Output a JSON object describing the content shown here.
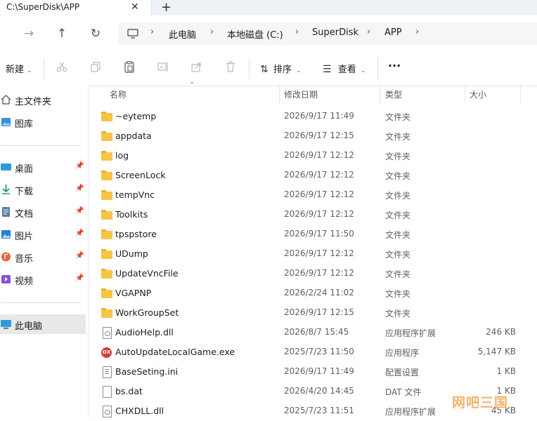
{
  "window": {
    "tab_title": "C:\\SuperDisk\\APP",
    "close_glyph": "✕",
    "add_glyph": "+"
  },
  "breadcrumb": [
    "此电脑",
    "本地磁盘 (C:)",
    "SuperDisk",
    "APP"
  ],
  "toolbar": {
    "new_label": "新建",
    "sort_label": "排序",
    "view_label": "查看",
    "more_label": "···"
  },
  "sidebar": {
    "items": [
      {
        "label": "主文件夹",
        "icon": "home-icon"
      },
      {
        "label": "图库",
        "icon": "gallery-icon"
      },
      {
        "label": "桌面",
        "icon": "desktop-icon",
        "pinned": true
      },
      {
        "label": "下载",
        "icon": "download-icon",
        "pinned": true
      },
      {
        "label": "文档",
        "icon": "documents-icon",
        "pinned": true
      },
      {
        "label": "图片",
        "icon": "pictures-icon",
        "pinned": true
      },
      {
        "label": "音乐",
        "icon": "music-icon",
        "pinned": true
      },
      {
        "label": "视频",
        "icon": "videos-icon",
        "pinned": true
      },
      {
        "label": "此电脑",
        "icon": "this-pc-icon",
        "selected": true
      }
    ]
  },
  "columns": {
    "name": "名称",
    "date": "修改日期",
    "type": "类型",
    "size": "大小"
  },
  "files": [
    {
      "name": "~eytemp",
      "date": "2026/9/17 11:49",
      "type": "文件夹",
      "size": "",
      "icon": "folder-icon"
    },
    {
      "name": "appdata",
      "date": "2026/9/17 12:15",
      "type": "文件夹",
      "size": "",
      "icon": "folder-icon"
    },
    {
      "name": "log",
      "date": "2026/9/17 12:12",
      "type": "文件夹",
      "size": "",
      "icon": "folder-icon"
    },
    {
      "name": "ScreenLock",
      "date": "2026/9/17 12:12",
      "type": "文件夹",
      "size": "",
      "icon": "folder-icon"
    },
    {
      "name": "tempVnc",
      "date": "2026/9/17 12:12",
      "type": "文件夹",
      "size": "",
      "icon": "folder-icon"
    },
    {
      "name": "Toolkits",
      "date": "2026/9/17 12:12",
      "type": "文件夹",
      "size": "",
      "icon": "folder-icon"
    },
    {
      "name": "tpspstore",
      "date": "2026/9/17 11:50",
      "type": "文件夹",
      "size": "",
      "icon": "folder-icon"
    },
    {
      "name": "UDump",
      "date": "2026/9/17 12:12",
      "type": "文件夹",
      "size": "",
      "icon": "folder-icon"
    },
    {
      "name": "UpdateVncFile",
      "date": "2026/9/17 12:12",
      "type": "文件夹",
      "size": "",
      "icon": "folder-icon"
    },
    {
      "name": "VGAPNP",
      "date": "2026/2/24 11:02",
      "type": "文件夹",
      "size": "",
      "icon": "folder-icon"
    },
    {
      "name": "WorkGroupSet",
      "date": "2026/9/17 12:15",
      "type": "文件夹",
      "size": "",
      "icon": "folder-icon"
    },
    {
      "name": "AudioHelp.dll",
      "date": "2026/8/7 15:45",
      "type": "应用程序扩展",
      "size": "246 KB",
      "icon": "dll-file-icon"
    },
    {
      "name": "AutoUpdateLocalGame.exe",
      "date": "2025/7/23 11:50",
      "type": "应用程序",
      "size": "5,147 KB",
      "icon": "exe-file-icon"
    },
    {
      "name": "BaseSeting.ini",
      "date": "2026/9/17 11:49",
      "type": "配置设置",
      "size": "1 KB",
      "icon": "ini-file-icon"
    },
    {
      "name": "bs.dat",
      "date": "2026/4/20 14:45",
      "type": "DAT 文件",
      "size": "1 KB",
      "icon": "dat-file-icon"
    },
    {
      "name": "CHXDLL.dll",
      "date": "2025/7/23 11:51",
      "type": "应用程序扩展",
      "size": "45 KB",
      "icon": "dll-file-icon"
    }
  ],
  "watermark": "网吧三国"
}
